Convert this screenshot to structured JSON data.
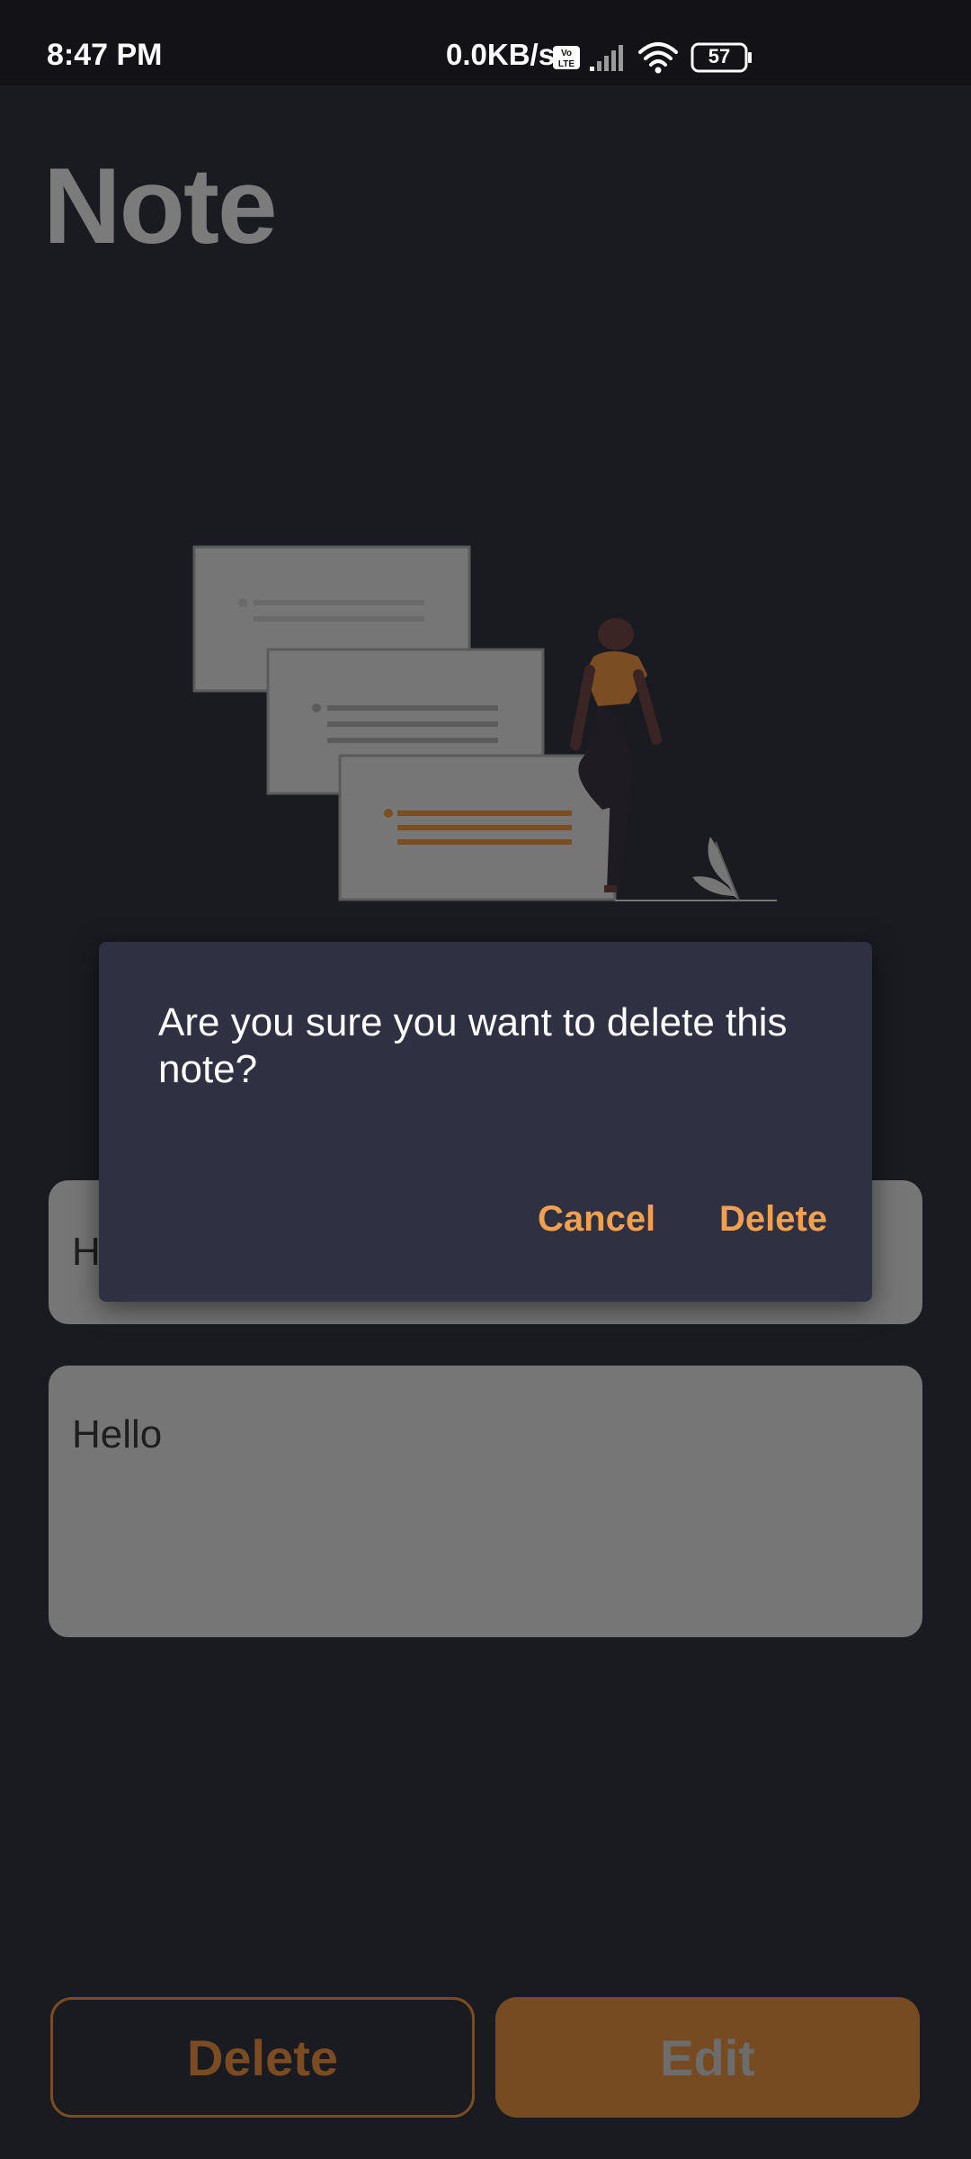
{
  "status_bar": {
    "time": "8:47 PM",
    "network_speed": "0.0KB/s",
    "battery_level": "57",
    "icons": [
      "volte-icon",
      "signal-icon",
      "wifi-icon",
      "battery-icon"
    ]
  },
  "page": {
    "title": "Note",
    "illustration": "notes-illustration",
    "fields": {
      "title_value": "H",
      "body_value": "Hello"
    }
  },
  "buttons": {
    "delete_label": "Delete",
    "edit_label": "Edit"
  },
  "dialog": {
    "message": "Are you sure you want to delete this note?",
    "cancel_label": "Cancel",
    "confirm_label": "Delete"
  },
  "colors": {
    "accent": "#f0a04e",
    "background": "#1a1a21",
    "dialog_background": "#2f3142"
  }
}
